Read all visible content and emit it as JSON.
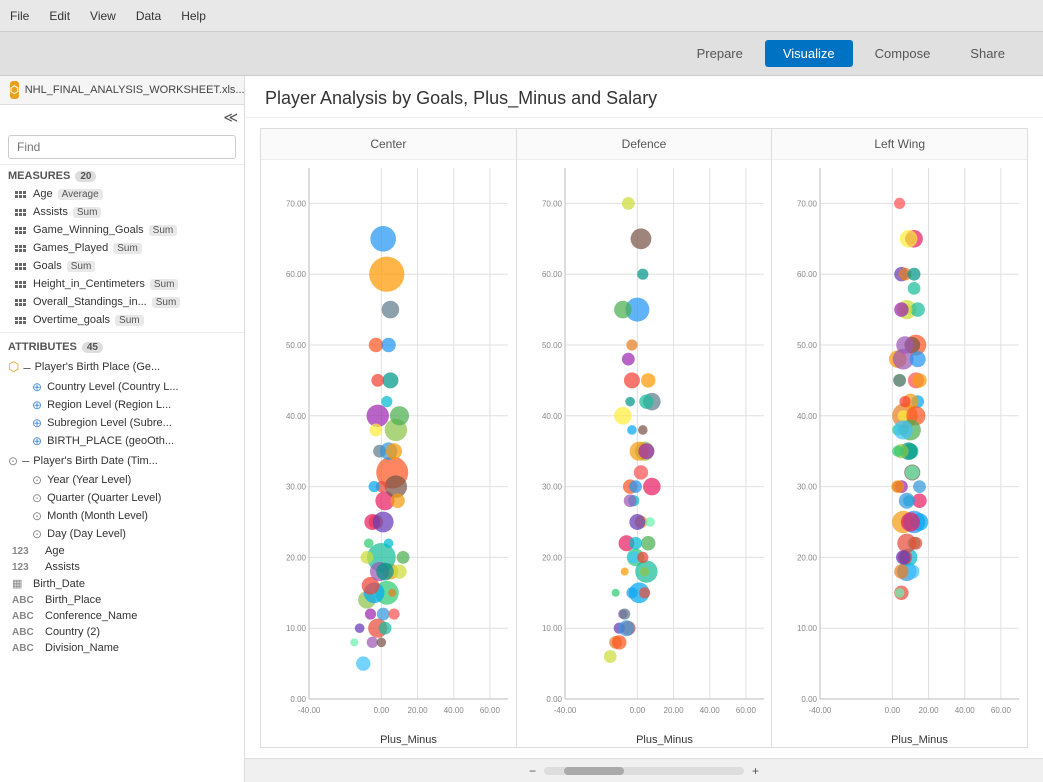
{
  "topbar": {
    "menus": [
      "File",
      "Edit",
      "View",
      "Data",
      "Help"
    ]
  },
  "navbar": {
    "buttons": [
      "Prepare",
      "Visualize",
      "Compose",
      "Share"
    ],
    "active": "Visualize"
  },
  "file": {
    "name": "NHL_FINAL_ANALYSIS_WORKSHEET.xls...",
    "icon_label": "⬡"
  },
  "sidebar": {
    "search_placeholder": "Find",
    "measures_label": "MEASURES",
    "measures_count": "20",
    "attributes_label": "ATTRIBUTES",
    "attributes_count": "45",
    "measures": [
      {
        "name": "Age",
        "badge": "Average"
      },
      {
        "name": "Assists",
        "badge": "Sum"
      },
      {
        "name": "Game_Winning_Goals",
        "badge": "Sum"
      },
      {
        "name": "Games_Played",
        "badge": "Sum"
      },
      {
        "name": "Goals",
        "badge": "Sum"
      },
      {
        "name": "Height_in_Centimeters",
        "badge": "Sum"
      },
      {
        "name": "Overall_Standings_in...",
        "badge": "Sum"
      },
      {
        "name": "Overtime_goals",
        "badge": "Sum"
      }
    ],
    "attributes": [
      {
        "type": "geo",
        "name": "Player's Birth Place (Ge...",
        "has_minus": true,
        "indent": 0
      },
      {
        "type": "globe",
        "name": "Country Level (Country L...",
        "indent": 1
      },
      {
        "type": "globe",
        "name": "Region Level (Region L...",
        "indent": 1
      },
      {
        "type": "globe",
        "name": "Subregion Level (Subre...",
        "indent": 1
      },
      {
        "type": "globe",
        "name": "BIRTH_PLACE (geoOth...",
        "indent": 1
      },
      {
        "type": "clock-parent",
        "name": "Player's Birth Date (Tim...",
        "has_minus": true,
        "indent": 0
      },
      {
        "type": "clock",
        "name": "Year (Year Level)",
        "indent": 1
      },
      {
        "type": "clock",
        "name": "Quarter (Quarter Level)",
        "indent": 1
      },
      {
        "type": "clock",
        "name": "Month (Month Level)",
        "indent": 1
      },
      {
        "type": "clock",
        "name": "Day (Day Level)",
        "indent": 1
      },
      {
        "type": "123",
        "name": "Age",
        "indent": 0
      },
      {
        "type": "123",
        "name": "Assists",
        "indent": 0
      },
      {
        "type": "cal",
        "name": "Birth_Date",
        "indent": 0
      },
      {
        "type": "abc",
        "name": "Birth_Place",
        "indent": 0
      },
      {
        "type": "abc",
        "name": "Conference_Name",
        "indent": 0
      },
      {
        "type": "abc",
        "name": "Country (2)",
        "indent": 0
      },
      {
        "type": "abc",
        "name": "Division_Name",
        "indent": 0
      }
    ]
  },
  "chart": {
    "title": "Player Analysis by Goals, Plus_Minus and Salary",
    "panels": [
      {
        "title": "Center",
        "x_label": "Plus_Minus"
      },
      {
        "title": "Defence",
        "x_label": "Plus_Minus"
      },
      {
        "title": "Left Wing",
        "x_label": "Plus_Minus"
      }
    ],
    "y_labels": [
      "0.00",
      "10.00",
      "20.00",
      "30.00",
      "40.00",
      "50.00",
      "60.00",
      "70.00"
    ],
    "x_labels": [
      "-40.00",
      "0.00",
      "20.00",
      "40.00",
      "60.00"
    ]
  }
}
